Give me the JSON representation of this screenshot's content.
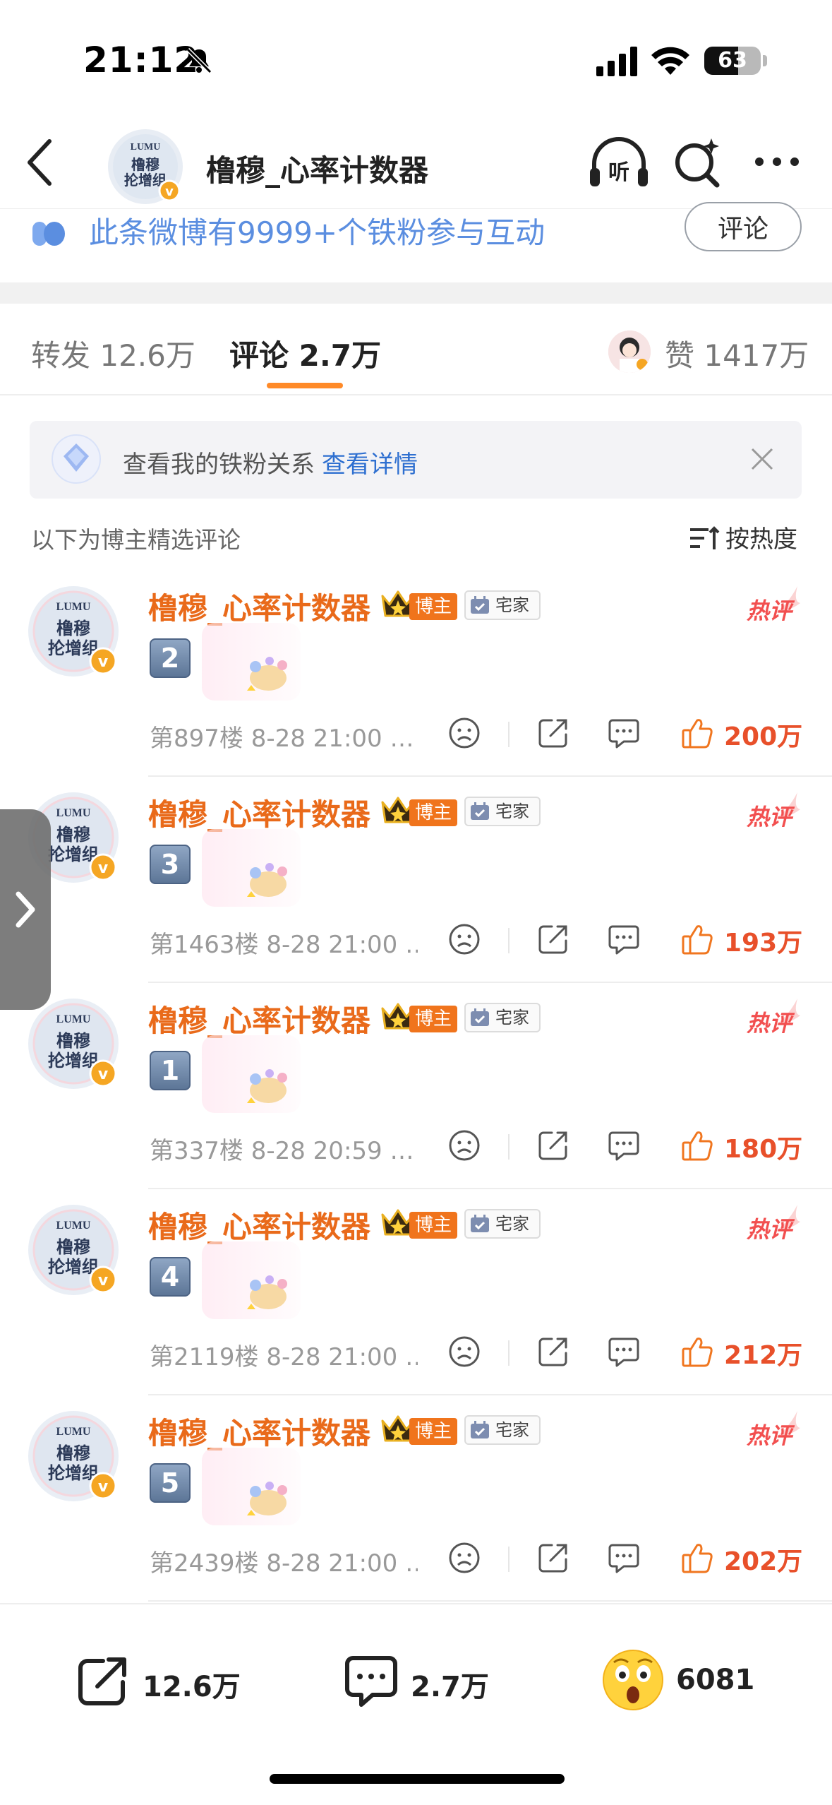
{
  "status": {
    "time": "21:12",
    "battery": "63"
  },
  "header": {
    "title": "橹穆_心率计数器",
    "avatar_text": "LUMU 橹穆 抡增组"
  },
  "fans_banner": {
    "text": "此条微博有9999+个铁粉参与互动",
    "button": "评论"
  },
  "tabs": {
    "repost": "转发 12.6万",
    "comment": "评论 2.7万",
    "like": "赞 1417万"
  },
  "iron_fans": {
    "text": "查看我的铁粉关系",
    "link": "查看详情"
  },
  "picked": {
    "title": "以下为博主精选评论",
    "sort": "按热度"
  },
  "comment_common": {
    "author": "橹穆_心率计数器",
    "role_badge": "博主",
    "tag": "宅家",
    "hot": "热评"
  },
  "comments": [
    {
      "num": "2",
      "meta": "第897楼 8-28 21:00 …",
      "likes": "200万"
    },
    {
      "num": "3",
      "meta": "第1463楼 8-28 21:00 …",
      "likes": "193万"
    },
    {
      "num": "1",
      "meta": "第337楼 8-28 20:59 …",
      "likes": "180万"
    },
    {
      "num": "4",
      "meta": "第2119楼 8-28 21:00 …",
      "likes": "212万"
    },
    {
      "num": "5",
      "meta": "第2439楼 8-28 21:00 …",
      "likes": "202万"
    }
  ],
  "bottom": {
    "repost": "12.6万",
    "comment": "2.7万",
    "like": "6081"
  }
}
